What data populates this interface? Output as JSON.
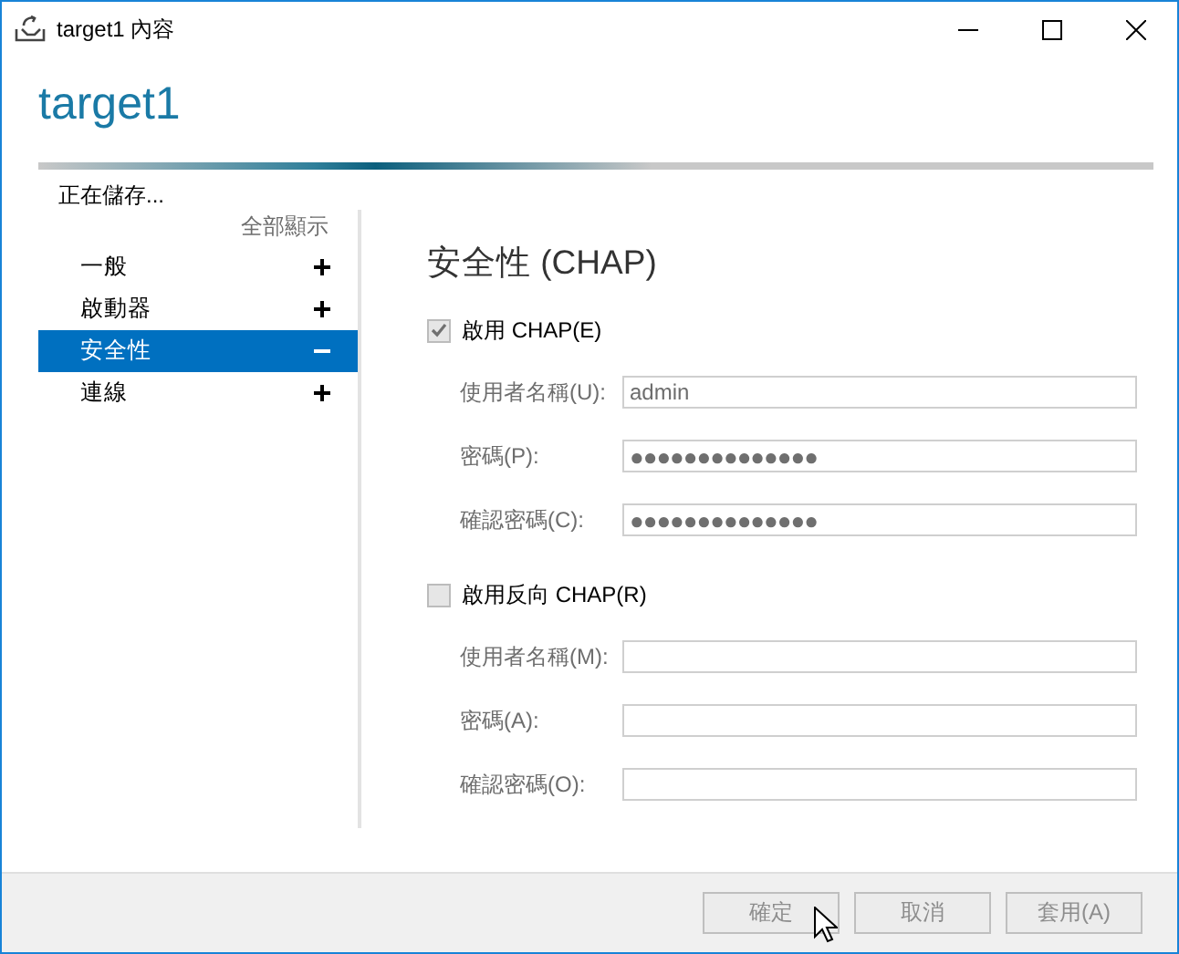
{
  "window": {
    "title": "target1 內容"
  },
  "heading": "target1",
  "progress": {
    "level": 0.55
  },
  "status": "正在儲存...",
  "sidebar": {
    "show_all": "全部顯示",
    "items": [
      {
        "label": "一般",
        "selected": false,
        "expanded": false
      },
      {
        "label": "啟動器",
        "selected": false,
        "expanded": false
      },
      {
        "label": "安全性",
        "selected": true,
        "expanded": true
      },
      {
        "label": "連線",
        "selected": false,
        "expanded": false
      }
    ]
  },
  "section_title": "安全性 (CHAP)",
  "groups": [
    {
      "label": "啟用 CHAP(E)",
      "checked": true,
      "disabled": true,
      "fields": [
        {
          "label": "使用者名稱(U):",
          "value": "admin",
          "kind": "text",
          "disabled": true
        },
        {
          "label": "密碼(P):",
          "value": "●●●●●●●●●●●●●●",
          "kind": "password",
          "disabled": true
        },
        {
          "label": "確認密碼(C):",
          "value": "●●●●●●●●●●●●●●",
          "kind": "password",
          "disabled": true
        }
      ]
    },
    {
      "label": "啟用反向 CHAP(R)",
      "checked": false,
      "disabled": true,
      "fields": [
        {
          "label": "使用者名稱(M):",
          "kind": "text",
          "disabled": true
        },
        {
          "label": "密碼(A):",
          "kind": "password",
          "disabled": true
        },
        {
          "label": "確認密碼(O):",
          "kind": "password",
          "disabled": true
        }
      ]
    }
  ],
  "buttons": [
    {
      "label": "確定",
      "disabled": true
    },
    {
      "label": "取消",
      "disabled": true
    },
    {
      "label": "套用(A)",
      "disabled": true
    }
  ]
}
